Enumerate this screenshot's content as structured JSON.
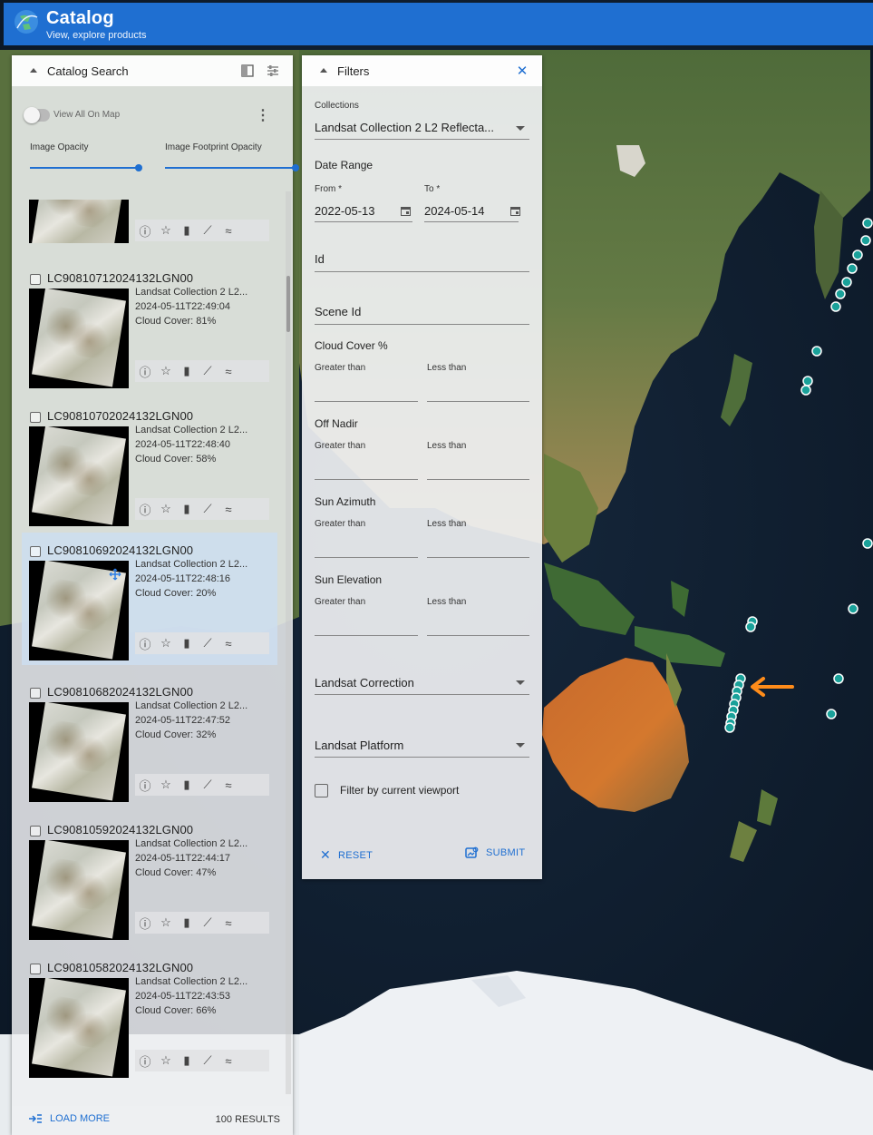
{
  "app": {
    "title": "Catalog",
    "subtitle": "View, explore products"
  },
  "catalog": {
    "title": "Catalog Search",
    "view_all_label": "View All On Map",
    "image_opacity_label": "Image Opacity",
    "footprint_opacity_label": "Image Footprint Opacity",
    "image_opacity": 0.83,
    "footprint_opacity": 0.99,
    "items": [
      {
        "id": "",
        "collection": "",
        "datetime": "",
        "cloud": "",
        "selected": false
      },
      {
        "id": "LC90810712024132LGN00",
        "collection": "Landsat Collection 2 L2...",
        "datetime": "2024-05-11T22:49:04",
        "cloud": "Cloud Cover: 81%",
        "selected": false
      },
      {
        "id": "LC90810702024132LGN00",
        "collection": "Landsat Collection 2 L2...",
        "datetime": "2024-05-11T22:48:40",
        "cloud": "Cloud Cover: 58%",
        "selected": false
      },
      {
        "id": "LC90810692024132LGN00",
        "collection": "Landsat Collection 2 L2...",
        "datetime": "2024-05-11T22:48:16",
        "cloud": "Cloud Cover: 20%",
        "selected": true
      },
      {
        "id": "LC90810682024132LGN00",
        "collection": "Landsat Collection 2 L2...",
        "datetime": "2024-05-11T22:47:52",
        "cloud": "Cloud Cover: 32%",
        "selected": false
      },
      {
        "id": "LC90810592024132LGN00",
        "collection": "Landsat Collection 2 L2...",
        "datetime": "2024-05-11T22:44:17",
        "cloud": "Cloud Cover: 47%",
        "selected": false
      },
      {
        "id": "LC90810582024132LGN00",
        "collection": "Landsat Collection 2 L2...",
        "datetime": "2024-05-11T22:43:53",
        "cloud": "Cloud Cover: 66%",
        "selected": false
      }
    ],
    "load_more": "LOAD MORE",
    "results": "100 RESULTS"
  },
  "filters": {
    "title": "Filters",
    "collections_label": "Collections",
    "collections_value": "Landsat Collection 2 L2 Reflecta...",
    "date_range_label": "Date Range",
    "from_label": "From *",
    "from_value": "2022-05-13",
    "to_label": "To *",
    "to_value": "2024-05-14",
    "id_label": "Id",
    "scene_id_label": "Scene Id",
    "cloud_label": "Cloud Cover %",
    "off_nadir_label": "Off Nadir",
    "sun_azimuth_label": "Sun Azimuth",
    "sun_elevation_label": "Sun Elevation",
    "greater_than": "Greater than",
    "less_than": "Less than",
    "correction_label": "Landsat Correction",
    "platform_label": "Landsat Platform",
    "viewport_label": "Filter by current viewport",
    "reset_label": "RESET",
    "submit_label": "SUBMIT"
  },
  "colors": {
    "accent": "#1f6fd1",
    "footprint": "#1aa19a",
    "arrow": "#ff8c1a"
  }
}
